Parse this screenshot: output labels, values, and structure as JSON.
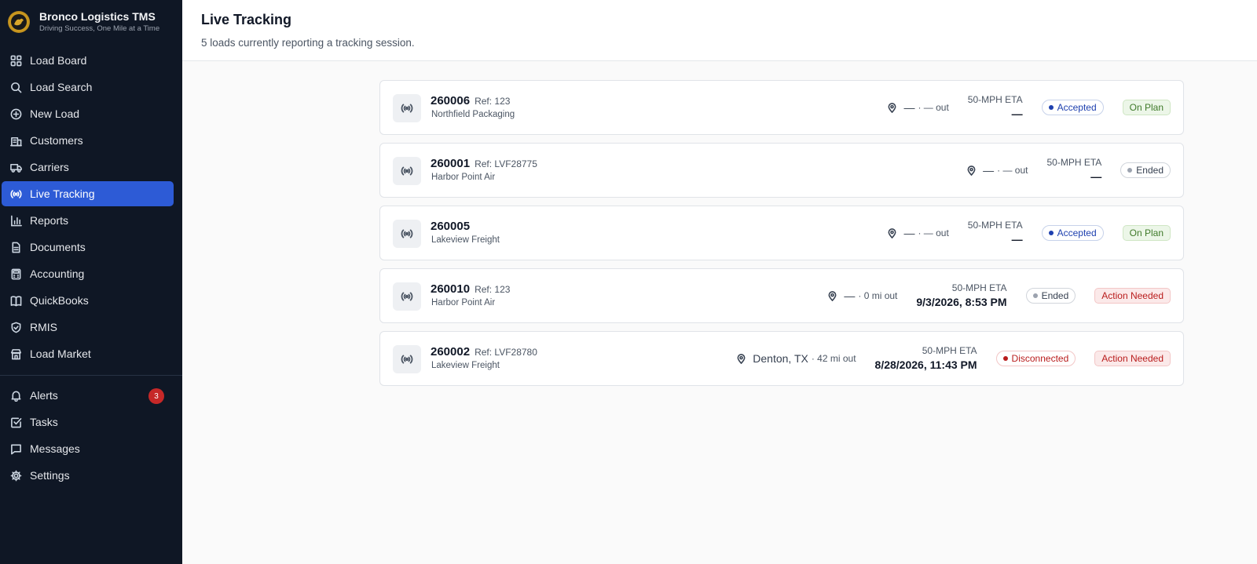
{
  "app": {
    "name": "Bronco Logistics TMS",
    "tagline": "Driving Success, One Mile at a Time"
  },
  "sidebar": {
    "items": [
      {
        "label": "Load Board",
        "icon": "grid-icon"
      },
      {
        "label": "Load Search",
        "icon": "search-icon"
      },
      {
        "label": "New Load",
        "icon": "plus-circle-icon"
      },
      {
        "label": "Customers",
        "icon": "building-icon"
      },
      {
        "label": "Carriers",
        "icon": "truck-icon"
      },
      {
        "label": "Live Tracking",
        "icon": "broadcast-icon",
        "active": true
      },
      {
        "label": "Reports",
        "icon": "bar-chart-icon"
      },
      {
        "label": "Documents",
        "icon": "file-icon"
      },
      {
        "label": "Accounting",
        "icon": "calculator-icon"
      },
      {
        "label": "QuickBooks",
        "icon": "book-icon"
      },
      {
        "label": "RMIS",
        "icon": "shield-check-icon"
      },
      {
        "label": "Load Market",
        "icon": "store-icon"
      }
    ],
    "secondary": [
      {
        "label": "Alerts",
        "icon": "bell-icon",
        "badge": "3"
      },
      {
        "label": "Tasks",
        "icon": "check-square-icon"
      },
      {
        "label": "Messages",
        "icon": "message-icon"
      },
      {
        "label": "Settings",
        "icon": "gear-icon"
      }
    ]
  },
  "page": {
    "title": "Live Tracking",
    "subtitle": "5 loads currently reporting a tracking session."
  },
  "loads": [
    {
      "id": "260006",
      "ref": "Ref: 123",
      "customer": "Northfield Packaging",
      "location": "—",
      "out": "· — out",
      "eta_label": "50-MPH ETA",
      "eta_value": "—",
      "status": "Accepted",
      "plan": "On Plan"
    },
    {
      "id": "260001",
      "ref": "Ref: LVF28775",
      "customer": "Harbor Point Air",
      "location": "—",
      "out": "· — out",
      "eta_label": "50-MPH ETA",
      "eta_value": "—",
      "status": "Ended",
      "plan": ""
    },
    {
      "id": "260005",
      "ref": "",
      "customer": "Lakeview Freight",
      "location": "—",
      "out": "· — out",
      "eta_label": "50-MPH ETA",
      "eta_value": "—",
      "status": "Accepted",
      "plan": "On Plan"
    },
    {
      "id": "260010",
      "ref": "Ref: 123",
      "customer": "Harbor Point Air",
      "location": "—",
      "out": "· 0 mi out",
      "eta_label": "50-MPH ETA",
      "eta_value": "9/3/2026, 8:53 PM",
      "status": "Ended",
      "plan": "Action Needed"
    },
    {
      "id": "260002",
      "ref": "Ref: LVF28780",
      "customer": "Lakeview Freight",
      "location": "Denton, TX",
      "out": "· 42 mi out",
      "eta_label": "50-MPH ETA",
      "eta_value": "8/28/2026, 11:43 PM",
      "status": "Disconnected",
      "plan": "Action Needed"
    }
  ],
  "colors": {
    "sidebar_bg": "#0f1725",
    "active_nav": "#2d5bd6",
    "accepted": "#1e40af",
    "ended": "#374151",
    "disconnected": "#b91c1c",
    "on_plan_bg": "#ecf6e8",
    "on_plan_text": "#3f7a2a",
    "action_bg": "#fbe9e9",
    "action_text": "#b91c1c"
  }
}
